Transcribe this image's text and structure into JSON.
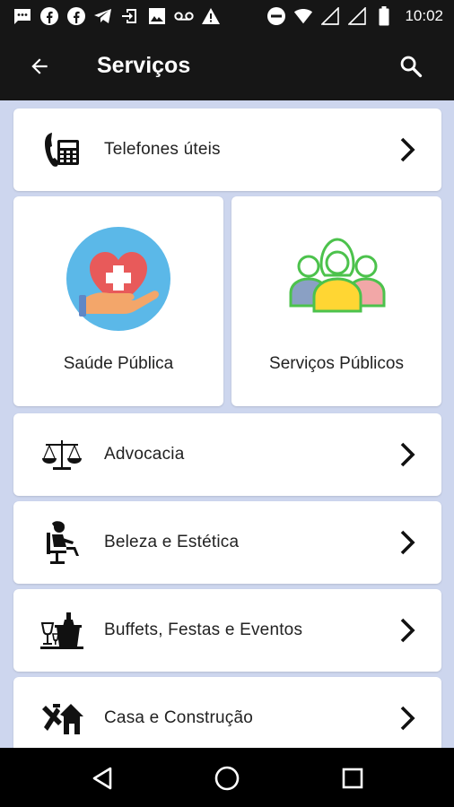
{
  "status_bar": {
    "time": "10:02",
    "icons": [
      "sms-icon",
      "facebook-icon",
      "facebook-icon",
      "telegram-icon",
      "screen-share-icon",
      "image-icon",
      "voicemail-icon",
      "warning-icon",
      "do-not-disturb-icon",
      "wifi-icon",
      "signal-icon",
      "signal-icon",
      "battery-icon"
    ]
  },
  "app_bar": {
    "title": "Serviços",
    "back_icon": "arrow-back-icon",
    "search_icon": "search-icon"
  },
  "services": {
    "phones": {
      "label": "Telefones úteis",
      "icon": "phone-contacts-icon"
    },
    "tiles": [
      {
        "label": "Saúde Pública",
        "icon": "health-heart-icon"
      },
      {
        "label": "Serviços Públicos",
        "icon": "people-group-icon"
      }
    ],
    "list": [
      {
        "label": "Advocacia",
        "icon": "scales-icon"
      },
      {
        "label": "Beleza e Estética",
        "icon": "salon-chair-icon"
      },
      {
        "label": "Buffets, Festas e Eventos",
        "icon": "champagne-icon"
      },
      {
        "label": "Casa e Construção",
        "icon": "house-tools-icon"
      }
    ]
  },
  "nav_bar": {
    "icons": [
      "back-triangle-icon",
      "home-circle-icon",
      "recents-square-icon"
    ]
  },
  "colors": {
    "bar": "#161616",
    "background": "#cdd6ee",
    "card": "#ffffff",
    "health_bg": "#5bb8e8",
    "heart": "#e85a5a",
    "people_green": "#4cc24c"
  }
}
